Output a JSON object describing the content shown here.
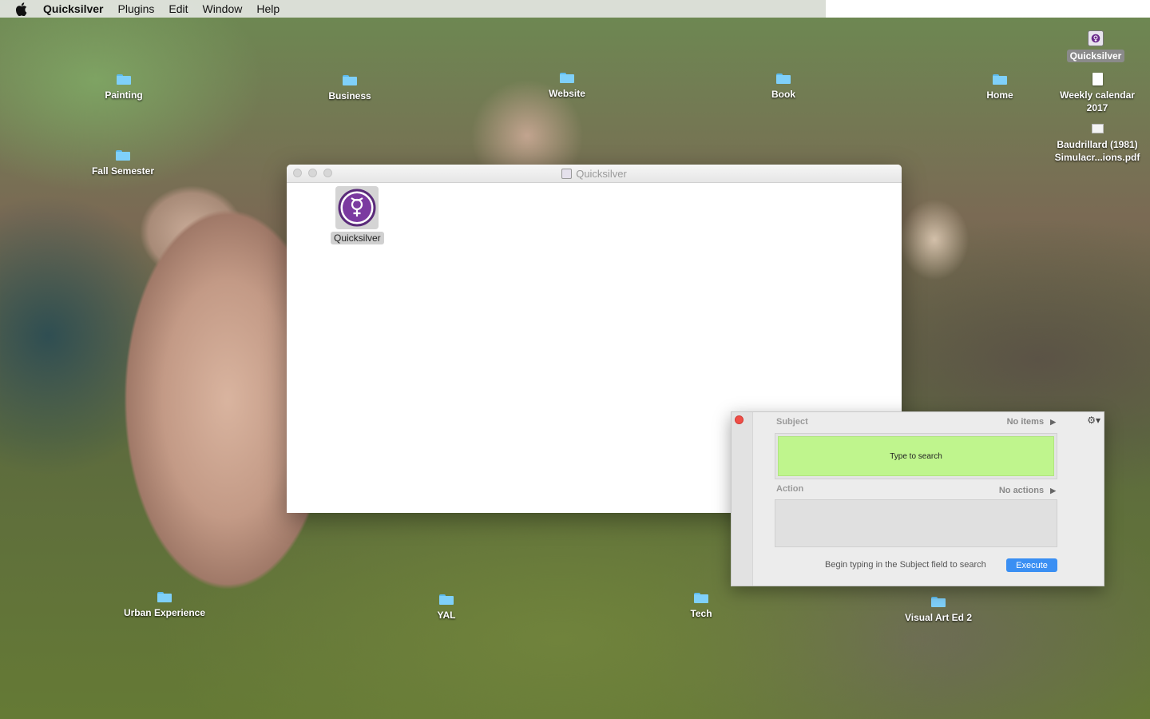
{
  "menubar": {
    "app_name": "Quicksilver",
    "items": [
      "Plugins",
      "Edit",
      "Window",
      "Help"
    ]
  },
  "desktop": {
    "top_icons": [
      {
        "label": "Painting"
      },
      {
        "label": "Business"
      },
      {
        "label": "Website"
      },
      {
        "label": "Book"
      },
      {
        "label": "Home"
      }
    ],
    "fall_semester": "Fall Semester",
    "right_column": {
      "quicksilver": "Quicksilver",
      "weekly_calendar": "Weekly calendar 2017",
      "pdf": "Baudrillard (1981) Simulacr...ions.pdf"
    },
    "bottom_icons": [
      {
        "label": "Urban Experience"
      },
      {
        "label": "YAL"
      },
      {
        "label": "Tech"
      },
      {
        "label": "Visual Art Ed 2"
      }
    ]
  },
  "finder_window": {
    "title": "Quicksilver",
    "item_label": "Quicksilver"
  },
  "qs_panel": {
    "subject_label": "Subject",
    "subject_status": "No items",
    "search_placeholder": "Type to search",
    "action_label": "Action",
    "action_status": "No actions",
    "hint": "Begin typing in the Subject field to search",
    "execute_label": "Execute"
  },
  "colors": {
    "search_field": "#bff58d",
    "execute_button": "#3a8ff3",
    "close_button": "#ef4e47",
    "folder": "#7fd0fa"
  }
}
